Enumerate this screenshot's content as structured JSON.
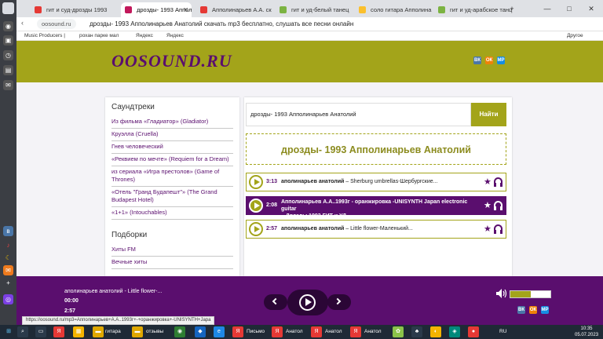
{
  "browser": {
    "tabs": [
      {
        "label": "гит и суд-дрозды 1993",
        "active": false
      },
      {
        "label": "дрозды- 1993 Апполи",
        "active": true
      },
      {
        "label": "Апполинарьев А.А. ск",
        "active": false
      },
      {
        "label": "гит и уд-белый танец",
        "active": false
      },
      {
        "label": "соло гитара Апполина",
        "active": false
      },
      {
        "label": "гит и уд-арабское танц",
        "active": false
      }
    ],
    "address": "oosound.ru",
    "page_title": "дрозды- 1993 Апполинарьев Анатолий скачать mp3 бесплатно, слушать все песни онлайн",
    "bookmarks": [
      "Music Producers |",
      "рохан парке мал",
      "Яндекс",
      "Яндекс"
    ],
    "bookmarks_other": "Другое"
  },
  "site": {
    "logo": "OOSOUND.RU",
    "social": [
      "ВК",
      "ОК",
      "МР"
    ],
    "sidebar": {
      "soundtracks_title": "Саундтреки",
      "soundtracks": [
        "Из фильма «Гладиатор» (Gladiator)",
        "Круэлла (Cruella)",
        "Гнев человеческий",
        "«Реквием по мечте» (Requiem for a Dream)",
        "из сериала «Игра престолов» (Game of Thrones)",
        "«Отель \"Гранд Будапешт\"» (The Grand Budapest Hotel)",
        "«1+1» (Intouchables)"
      ],
      "collections_title": "Подборки",
      "collections": [
        "Хиты FM",
        "Вечные хиты"
      ]
    },
    "search": {
      "value": "дрозды- 1993 Апполинарьев Анатолий",
      "button": "Найти"
    },
    "heading": "дрозды- 1993 Апполинарьев Анатолий",
    "tracks": [
      {
        "duration": "3:13",
        "artist": "аполинарьев анатолий",
        "title": " – Sherburg umbrellas-Шербургские...",
        "playing": false
      },
      {
        "duration": "2:08",
        "artist": "Апполинарьев А.А..1993г - оранжировка -UNISYNTH Japan electronic guitar",
        "title": "– Дрозды 1993 ГИТ и УД",
        "playing": true
      },
      {
        "duration": "2:57",
        "artist": "аполинарьев анатолий",
        "title": " – Little flower-Маленький...",
        "playing": false
      }
    ]
  },
  "player": {
    "now_playing": "аполинарьев анатолий - Little flower-...",
    "time_current": "00:00",
    "time_total": "2:57",
    "volume_percent": 50
  },
  "status_url": "https://oosound.ru/mp3=Апполинарьев+А.А..1993г+-+оранжировка+-UNISYNTH+Japa",
  "taskbar": {
    "apps": [
      "гитара",
      "отзывы",
      "Письмо",
      "Анатол",
      "Анатол",
      "Анатол"
    ],
    "lang": "RU",
    "time": "10:35",
    "date": "05.07.2023"
  },
  "colors": {
    "accent": "#a3a41a",
    "brand": "#5a0e6e"
  }
}
